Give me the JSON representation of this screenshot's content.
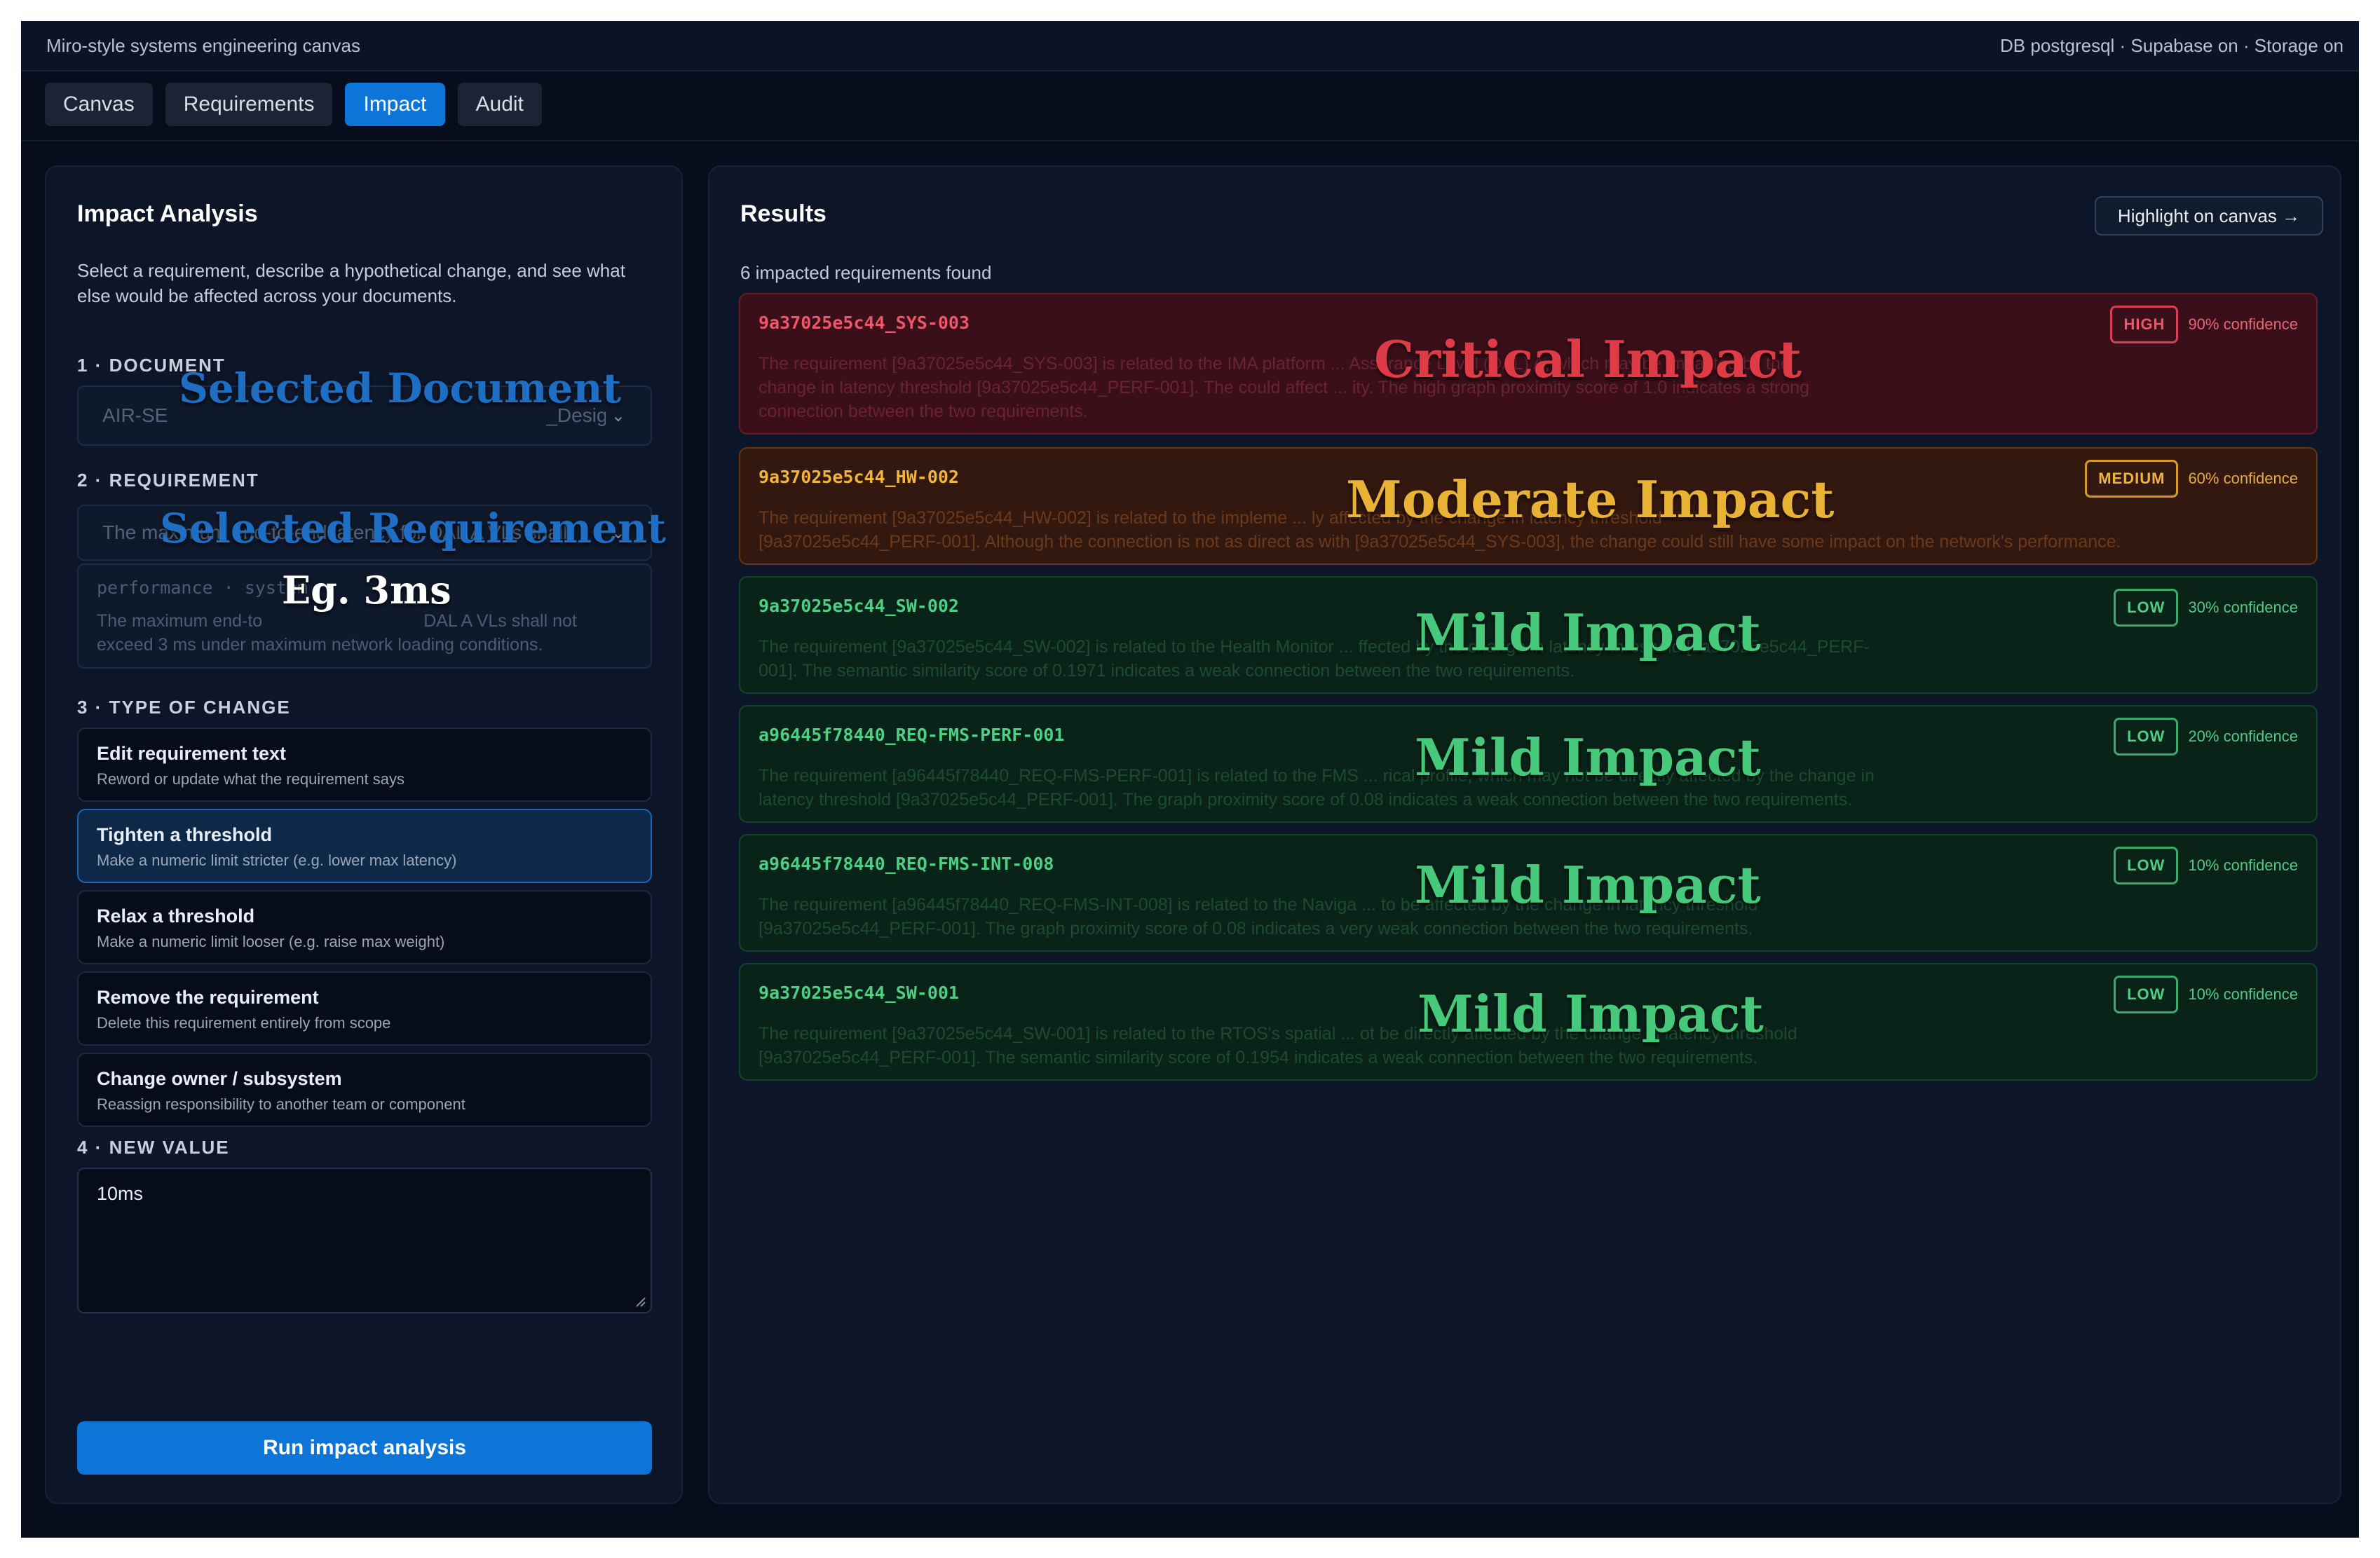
{
  "topbar": {
    "app_title": "Miro-style systems engineering canvas",
    "status": "DB postgresql · Supabase on · Storage on"
  },
  "tabs": [
    {
      "label": "Canvas",
      "active": false
    },
    {
      "label": "Requirements",
      "active": false
    },
    {
      "label": "Impact",
      "active": true
    },
    {
      "label": "Audit",
      "active": false
    }
  ],
  "left": {
    "title": "Impact Analysis",
    "description": "Select a requirement, describe a hypothetical change, and see what else would be affected across your documents.",
    "document": {
      "label": "1 · DOCUMENT",
      "value": "AIR-SE",
      "value_suffix": "_Design"
    },
    "requirement": {
      "label": "2 · REQUIREMENT",
      "value": "The maximum end-to-end latency for DAL A VLs shall",
      "tags": "performance · system",
      "text_start": "The maximum end-to",
      "text_end": "DAL A VLs shall not",
      "text_line2": "exceed 3 ms under maximum network loading conditions."
    },
    "change_type": {
      "label": "3 · TYPE OF CHANGE",
      "options": [
        {
          "title": "Edit requirement text",
          "sub": "Reword or update what the requirement says",
          "selected": false
        },
        {
          "title": "Tighten a threshold",
          "sub": "Make a numeric limit stricter (e.g. lower max latency)",
          "selected": true
        },
        {
          "title": "Relax a threshold",
          "sub": "Make a numeric limit looser (e.g. raise max weight)",
          "selected": false
        },
        {
          "title": "Remove the requirement",
          "sub": "Delete this requirement entirely from scope",
          "selected": false
        },
        {
          "title": "Change owner / subsystem",
          "sub": "Reassign responsibility to another team or component",
          "selected": false
        }
      ]
    },
    "new_value": {
      "label": "4 · NEW VALUE",
      "value": "10ms"
    },
    "run_label": "Run impact analysis"
  },
  "results": {
    "title": "Results",
    "highlight_label": "Highlight on canvas →",
    "count_text": "6 impacted requirements found",
    "cards": [
      {
        "severity": "high",
        "id": "9a37025e5c44_SYS-003",
        "badge": "HIGH",
        "confidence": "90% confidence",
        "lines": [
          "The requirement [9a37025e5c44_SYS-003] is related to the IMA platform ... Assurance Level (DAL) A, which may be impacted by the",
          "change in latency threshold [9a37025e5c44_PERF-001]. The could affect ... ity. The high graph proximity score of 1.0 indicates a strong",
          "connection between the two requirements."
        ]
      },
      {
        "severity": "medium",
        "id": "9a37025e5c44_HW-002",
        "badge": "MEDIUM",
        "confidence": "60% confidence",
        "lines": [
          "The requirement [9a37025e5c44_HW-002] is related to the impleme ... ly affected by the change in latency threshold",
          "[9a37025e5c44_PERF-001]. Although the connection is not as direct as with [9a37025e5c44_SYS-003], the change could still have some impact on the network's performance."
        ]
      },
      {
        "severity": "low",
        "id": "9a37025e5c44_SW-002",
        "badge": "LOW",
        "confidence": "30% confidence",
        "lines": [
          "The requirement [9a37025e5c44_SW-002] is related to the Health Monitor ... ffected by the change in latency threshold [9a37025e5c44_PERF-",
          "001]. The semantic similarity score of 0.1971 indicates a weak connection between the two requirements."
        ]
      },
      {
        "severity": "low",
        "id": "a96445f78440_REQ-FMS-PERF-001",
        "badge": "LOW",
        "confidence": "20% confidence",
        "lines": [
          "The requirement [a96445f78440_REQ-FMS-PERF-001] is related to the FMS ... rical profile, which may not be directly affected by the change in",
          "latency threshold [9a37025e5c44_PERF-001]. The graph proximity score of 0.08 indicates a weak connection between the two requirements."
        ]
      },
      {
        "severity": "low",
        "id": "a96445f78440_REQ-FMS-INT-008",
        "badge": "LOW",
        "confidence": "10% confidence",
        "lines": [
          "The requirement [a96445f78440_REQ-FMS-INT-008] is related to the Naviga ... to be affected by the change in latency threshold",
          "[9a37025e5c44_PERF-001]. The graph proximity score of 0.08 indicates a very weak connection between the two requirements."
        ]
      },
      {
        "severity": "low",
        "id": "9a37025e5c44_SW-001",
        "badge": "LOW",
        "confidence": "10% confidence",
        "lines": [
          "The requirement [9a37025e5c44_SW-001] is related to the RTOS's spatial ... ot be directly affected by the change in latency threshold",
          "[9a37025e5c44_PERF-001]. The semantic similarity score of 0.1954 indicates a weak connection between the two requirements."
        ]
      }
    ]
  },
  "annotations": {
    "selected_document": "Selected Document",
    "selected_requirement": "Selected Requirement",
    "example": "Eg. 3ms",
    "critical": "Critical Impact",
    "moderate": "Moderate Impact",
    "mild": "Mild Impact"
  },
  "colors": {
    "accent": "#0d74d8",
    "high": "#f0566a",
    "medium": "#f2b53c",
    "low": "#4fcf84",
    "annotation_blue": "#1e6fc4"
  }
}
